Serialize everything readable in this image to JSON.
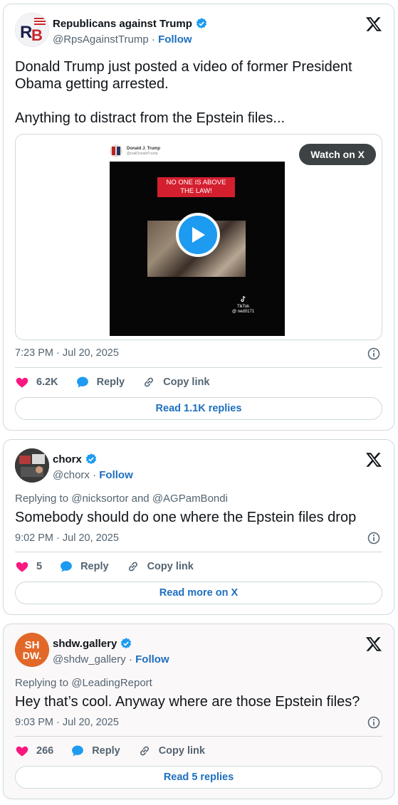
{
  "tweets": [
    {
      "display_name": "Republicans against Trump",
      "handle": "@RpsAgainstTrump",
      "separator": "·",
      "follow_label": "Follow",
      "replying_to": "",
      "text": "Donald Trump just posted a video of former President Obama getting arrested.\n\nAnything to distract from the Epstein files...",
      "timestamp": "7:23 PM · Jul 20, 2025",
      "likes": "6.2K",
      "reply_label": "Reply",
      "copy_label": "Copy link",
      "pill_label": "Read 1.1K replies",
      "avatar_text": "RB",
      "embed": {
        "name": "Donald J. Trump",
        "handle": "@realDonaldTrump",
        "caption": "NO ONE IS ABOVE THE LAW!",
        "watermark_label": "TikTok",
        "watermark_handle": "@ ned0171",
        "watch_label": "Watch on X"
      }
    },
    {
      "display_name": "chorx",
      "handle": "@chorx",
      "separator": "·",
      "follow_label": "Follow",
      "replying_to": "Replying to @nicksortor and @AGPamBondi",
      "text": "Somebody should do one where the Epstein files drop",
      "timestamp": "9:02 PM · Jul 20, 2025",
      "likes": "5",
      "reply_label": "Reply",
      "copy_label": "Copy link",
      "pill_label": "Read more on X"
    },
    {
      "display_name": "shdw.gallery",
      "handle": "@shdw_gallery",
      "separator": "·",
      "follow_label": "Follow",
      "replying_to": "Replying to @LeadingReport",
      "text": "Hey that’s cool. Anyway where are those Epstein files?",
      "timestamp": "9:03 PM · Jul 20, 2025",
      "likes": "266",
      "reply_label": "Reply",
      "copy_label": "Copy link",
      "pill_label": "Read 5 replies",
      "avatar_text": "SH DW."
    }
  ],
  "colors": {
    "accent_blue": "#1d9bf0",
    "link_blue": "#1d6fbf",
    "heart_pink": "#f91880",
    "muted_text": "#536471",
    "border": "#cfd9de"
  },
  "icons": {
    "verified": "verified-badge-icon",
    "x_logo": "x-logo-icon",
    "info": "info-icon",
    "like": "heart-icon",
    "reply": "speech-bubble-icon",
    "copy": "link-icon",
    "play": "play-icon"
  }
}
